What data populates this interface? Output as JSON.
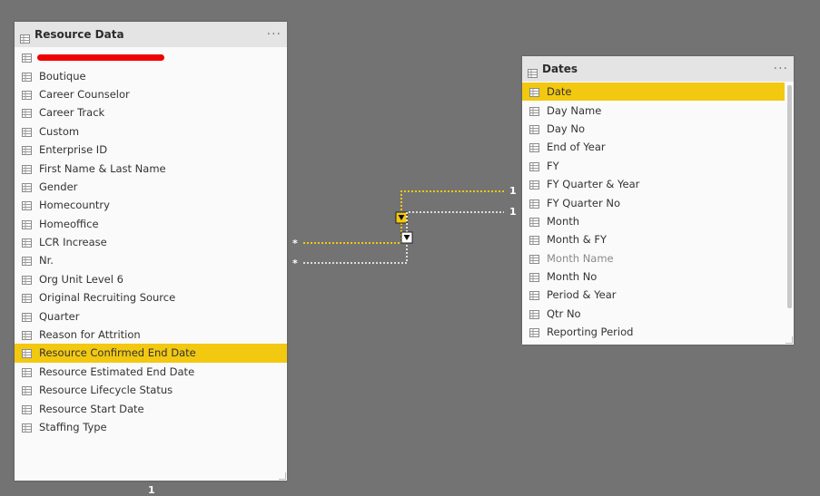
{
  "resource_table": {
    "title": "Resource Data",
    "more": "···",
    "fields": [
      {
        "label": "",
        "redacted": true
      },
      {
        "label": "Boutique"
      },
      {
        "label": "Career Counselor"
      },
      {
        "label": "Career Track"
      },
      {
        "label": "Custom"
      },
      {
        "label": "Enterprise ID"
      },
      {
        "label": "First Name & Last Name"
      },
      {
        "label": "Gender"
      },
      {
        "label": "Homecountry"
      },
      {
        "label": "Homeoffice"
      },
      {
        "label": "LCR Increase"
      },
      {
        "label": "Nr."
      },
      {
        "label": "Org Unit Level 6"
      },
      {
        "label": "Original Recruiting Source"
      },
      {
        "label": "Quarter"
      },
      {
        "label": "Reason for Attrition"
      },
      {
        "label": "Resource Confirmed End Date",
        "selected": true
      },
      {
        "label": "Resource Estimated End Date"
      },
      {
        "label": "Resource Lifecycle Status"
      },
      {
        "label": "Resource Start Date"
      },
      {
        "label": "Staffing Type"
      }
    ]
  },
  "dates_table": {
    "title": "Dates",
    "more": "···",
    "fields": [
      {
        "label": "Date",
        "selected": true
      },
      {
        "label": "Day Name"
      },
      {
        "label": "Day No"
      },
      {
        "label": "End of Year"
      },
      {
        "label": "FY"
      },
      {
        "label": "FY Quarter & Year"
      },
      {
        "label": "FY Quarter No"
      },
      {
        "label": "Month"
      },
      {
        "label": "Month & FY"
      },
      {
        "label": "Month Name",
        "muted": true
      },
      {
        "label": "Month No"
      },
      {
        "label": "Period & Year"
      },
      {
        "label": "Qtr No"
      },
      {
        "label": "Reporting Period"
      }
    ]
  },
  "relationships": [
    {
      "from_label": "*",
      "to_label": "1",
      "active": true
    },
    {
      "from_label": "*",
      "to_label": "1",
      "active": false
    }
  ],
  "bottom_label": "1",
  "colors": {
    "canvas": "#737373",
    "highlight": "#f2c811",
    "inactive_line": "#ffffff",
    "redaction": "#ee0000"
  }
}
